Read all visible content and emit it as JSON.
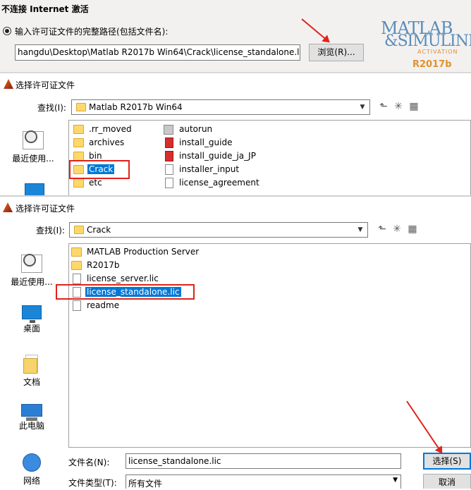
{
  "activation": {
    "title": "不连接 Internet 激活",
    "radio_label": "输入许可证文件的完整路径(包括文件名):",
    "path_value": "hangdu\\Desktop\\Matlab R2017b Win64\\Crack\\license_standalone.lic",
    "browse_label": "浏览(R)...",
    "logo_line1": "MATLAB",
    "logo_line2": "&SIMULINK",
    "logo_activation": "ACTIVATION",
    "logo_version": "R2017b"
  },
  "dialog1": {
    "title": "选择许可证文件",
    "look_in_label": "查找(I):",
    "look_in_value": "Matlab R2017b Win64",
    "places": [
      {
        "label": "最近使用..."
      }
    ],
    "files_col1": [
      ".rr_moved",
      "archives",
      "bin",
      "Crack",
      "etc"
    ],
    "files_col2": [
      "autorun",
      "install_guide",
      "install_guide_ja_JP",
      "installer_input",
      "license_agreement"
    ],
    "selected": "Crack"
  },
  "dialog2": {
    "title": "选择许可证文件",
    "look_in_label": "查找(I):",
    "look_in_value": "Crack",
    "places": [
      {
        "label": "最近使用...",
        "icon": "recent-icon"
      },
      {
        "label": "桌面",
        "icon": "desktop-icon"
      },
      {
        "label": "文档",
        "icon": "documents-icon"
      },
      {
        "label": "此电脑",
        "icon": "this-pc-icon"
      },
      {
        "label": "网络",
        "icon": "network-icon"
      }
    ],
    "files": [
      {
        "name": "MATLAB Production Server",
        "type": "folder"
      },
      {
        "name": "R2017b",
        "type": "folder"
      },
      {
        "name": "license_server.lic",
        "type": "file"
      },
      {
        "name": "license_standalone.lic",
        "type": "file"
      },
      {
        "name": "readme",
        "type": "text"
      }
    ],
    "selected": "license_standalone.lic",
    "filename_label": "文件名(N):",
    "filename_value": "license_standalone.lic",
    "filetype_label": "文件类型(T):",
    "filetype_value": "所有文件",
    "select_button": "选择(S)",
    "cancel_button": "取消"
  },
  "colors": {
    "selection": "#0078d7",
    "highlight_box": "#e0221b",
    "panel_bg": "#f2f1f0",
    "logo_blue": "#5a8cb8",
    "logo_orange": "#e98a2d"
  }
}
